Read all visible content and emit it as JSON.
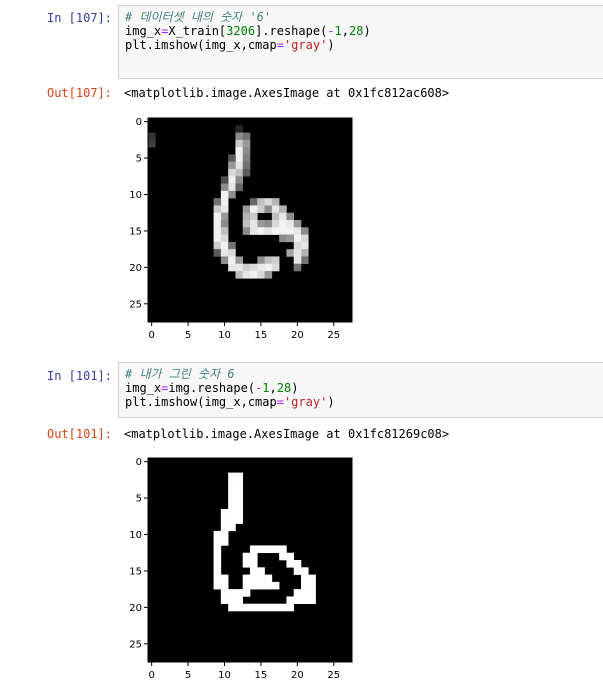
{
  "cells": [
    {
      "in_prompt": "In [107]:",
      "code": [
        [
          {
            "t": "# 데이터셋 내의 숫자 '6'",
            "c": "cmt"
          }
        ],
        [
          {
            "t": "img_x",
            "c": ""
          },
          {
            "t": "=",
            "c": "op"
          },
          {
            "t": "X_train[",
            "c": ""
          },
          {
            "t": "3206",
            "c": "num"
          },
          {
            "t": "].reshape(",
            "c": ""
          },
          {
            "t": "-",
            "c": "op"
          },
          {
            "t": "1",
            "c": "num"
          },
          {
            "t": ",",
            "c": ""
          },
          {
            "t": "28",
            "c": "num"
          },
          {
            "t": ")",
            "c": ""
          }
        ],
        [
          {
            "t": "plt.imshow(img_x,cmap",
            "c": ""
          },
          {
            "t": "=",
            "c": "op"
          },
          {
            "t": "'gray'",
            "c": "str"
          },
          {
            "t": ")",
            "c": ""
          }
        ]
      ],
      "out_prompt": "Out[107]:",
      "out_text": "<matplotlib.image.AxesImage at 0x1fc812ac608>",
      "plot": {
        "y_ticks": [
          "0",
          "5",
          "10",
          "15",
          "20",
          "25"
        ],
        "x_ticks": [
          "0",
          "5",
          "10",
          "15",
          "20",
          "25"
        ],
        "image": {
          "rows": 28,
          "cols": 28,
          "pixels": [
            [
              2,
              0,
              0.2
            ],
            [
              3,
              0,
              0.25
            ],
            [
              1,
              12,
              0.15
            ],
            [
              2,
              12,
              0.55
            ],
            [
              3,
              12,
              0.8
            ],
            [
              4,
              12,
              0.95
            ],
            [
              5,
              12,
              0.95
            ],
            [
              6,
              12,
              0.9
            ],
            [
              7,
              12,
              0.75
            ],
            [
              2,
              13,
              0.45
            ],
            [
              3,
              13,
              0.6
            ],
            [
              4,
              13,
              0.55
            ],
            [
              5,
              13,
              0.5
            ],
            [
              6,
              13,
              0.45
            ],
            [
              7,
              13,
              0.35
            ],
            [
              5,
              11,
              0.35
            ],
            [
              6,
              11,
              0.6
            ],
            [
              7,
              11,
              0.85
            ],
            [
              8,
              11,
              0.95
            ],
            [
              9,
              11,
              0.9
            ],
            [
              10,
              11,
              0.55
            ],
            [
              8,
              12,
              0.55
            ],
            [
              9,
              12,
              0.4
            ],
            [
              8,
              10,
              0.3
            ],
            [
              9,
              10,
              0.55
            ],
            [
              10,
              10,
              0.95
            ],
            [
              11,
              10,
              0.95
            ],
            [
              12,
              10,
              0.9
            ],
            [
              13,
              10,
              0.6
            ],
            [
              11,
              9,
              0.45
            ],
            [
              12,
              9,
              0.8
            ],
            [
              13,
              9,
              0.95
            ],
            [
              14,
              9,
              0.95
            ],
            [
              15,
              9,
              0.95
            ],
            [
              16,
              9,
              0.95
            ],
            [
              17,
              9,
              0.8
            ],
            [
              18,
              9,
              0.35
            ],
            [
              14,
              10,
              0.55
            ],
            [
              15,
              10,
              0.75
            ],
            [
              16,
              10,
              0.85
            ],
            [
              17,
              10,
              0.95
            ],
            [
              18,
              10,
              0.9
            ],
            [
              19,
              10,
              0.55
            ],
            [
              17,
              11,
              0.45
            ],
            [
              18,
              11,
              0.85
            ],
            [
              19,
              11,
              0.95
            ],
            [
              20,
              11,
              0.9
            ],
            [
              19,
              12,
              0.6
            ],
            [
              20,
              12,
              0.9
            ],
            [
              21,
              12,
              0.75
            ],
            [
              20,
              13,
              0.8
            ],
            [
              21,
              13,
              0.9
            ],
            [
              20,
              14,
              0.85
            ],
            [
              21,
              14,
              0.95
            ],
            [
              19,
              15,
              0.55
            ],
            [
              20,
              15,
              0.9
            ],
            [
              21,
              15,
              0.85
            ],
            [
              19,
              16,
              0.75
            ],
            [
              20,
              16,
              0.95
            ],
            [
              21,
              16,
              0.6
            ],
            [
              19,
              17,
              0.8
            ],
            [
              20,
              17,
              0.85
            ],
            [
              11,
              14,
              0.4
            ],
            [
              11,
              15,
              0.75
            ],
            [
              11,
              16,
              0.85
            ],
            [
              11,
              17,
              0.7
            ],
            [
              12,
              13,
              0.6
            ],
            [
              12,
              14,
              0.95
            ],
            [
              12,
              15,
              0.8
            ],
            [
              12,
              16,
              0.55
            ],
            [
              12,
              17,
              0.9
            ],
            [
              12,
              18,
              0.7
            ],
            [
              13,
              13,
              0.7
            ],
            [
              13,
              14,
              0.8
            ],
            [
              13,
              17,
              0.75
            ],
            [
              13,
              18,
              0.9
            ],
            [
              13,
              19,
              0.55
            ],
            [
              14,
              13,
              0.75
            ],
            [
              14,
              14,
              0.9
            ],
            [
              14,
              15,
              0.6
            ],
            [
              14,
              16,
              0.55
            ],
            [
              14,
              17,
              0.85
            ],
            [
              14,
              18,
              0.95
            ],
            [
              14,
              19,
              0.9
            ],
            [
              14,
              20,
              0.6
            ],
            [
              15,
              13,
              0.55
            ],
            [
              15,
              14,
              0.9
            ],
            [
              15,
              15,
              0.95
            ],
            [
              15,
              16,
              0.9
            ],
            [
              15,
              17,
              0.95
            ],
            [
              15,
              18,
              0.95
            ],
            [
              15,
              19,
              0.95
            ],
            [
              15,
              20,
              0.9
            ],
            [
              15,
              21,
              0.55
            ],
            [
              16,
              20,
              0.95
            ],
            [
              16,
              21,
              0.85
            ],
            [
              17,
              21,
              0.9
            ],
            [
              18,
              21,
              0.7
            ],
            [
              19,
              21,
              0.45
            ],
            [
              16,
              19,
              0.6
            ],
            [
              18,
              19,
              0.65
            ],
            [
              17,
              20,
              0.85
            ],
            [
              18,
              20,
              0.9
            ],
            [
              19,
              20,
              0.9
            ],
            [
              20,
              20,
              0.45
            ],
            [
              16,
              18,
              0.55
            ]
          ]
        }
      }
    },
    {
      "in_prompt": "In [101]:",
      "code": [
        [
          {
            "t": "# 내가 그린 숫자 6",
            "c": "cmt"
          }
        ],
        [
          {
            "t": "img_x",
            "c": ""
          },
          {
            "t": "=",
            "c": "op"
          },
          {
            "t": "img.reshape(",
            "c": ""
          },
          {
            "t": "-",
            "c": "op"
          },
          {
            "t": "1",
            "c": "num"
          },
          {
            "t": ",",
            "c": ""
          },
          {
            "t": "28",
            "c": "num"
          },
          {
            "t": ")",
            "c": ""
          }
        ],
        [
          {
            "t": "plt.imshow(img_x,cmap",
            "c": ""
          },
          {
            "t": "=",
            "c": "op"
          },
          {
            "t": "'gray'",
            "c": "str"
          },
          {
            "t": ")",
            "c": ""
          }
        ]
      ],
      "out_prompt": "Out[101]:",
      "out_text": "<matplotlib.image.AxesImage at 0x1fc81269c08>",
      "plot": {
        "y_ticks": [
          "0",
          "5",
          "10",
          "15",
          "20",
          "25"
        ],
        "x_ticks": [
          "0",
          "5",
          "10",
          "15",
          "20",
          "25"
        ],
        "image": {
          "rows": 28,
          "cols": 28,
          "pixels": [
            [
              2,
              11,
              1
            ],
            [
              3,
              11,
              1
            ],
            [
              4,
              11,
              1
            ],
            [
              5,
              11,
              1
            ],
            [
              6,
              11,
              1
            ],
            [
              7,
              11,
              1
            ],
            [
              8,
              11,
              1
            ],
            [
              9,
              11,
              1
            ],
            [
              2,
              12,
              1
            ],
            [
              3,
              12,
              1
            ],
            [
              4,
              12,
              1
            ],
            [
              5,
              12,
              1
            ],
            [
              6,
              12,
              1
            ],
            [
              7,
              12,
              1
            ],
            [
              8,
              12,
              1
            ],
            [
              7,
              10,
              1
            ],
            [
              8,
              10,
              1
            ],
            [
              9,
              10,
              1
            ],
            [
              10,
              10,
              1
            ],
            [
              11,
              10,
              1
            ],
            [
              10,
              9,
              1
            ],
            [
              11,
              9,
              1
            ],
            [
              12,
              9,
              1
            ],
            [
              13,
              9,
              1
            ],
            [
              14,
              9,
              1
            ],
            [
              15,
              9,
              1
            ],
            [
              16,
              9,
              1
            ],
            [
              17,
              9,
              1
            ],
            [
              16,
              10,
              1
            ],
            [
              17,
              10,
              1
            ],
            [
              18,
              10,
              1
            ],
            [
              19,
              10,
              1
            ],
            [
              18,
              11,
              1
            ],
            [
              19,
              11,
              1
            ],
            [
              20,
              11,
              1
            ],
            [
              19,
              12,
              1
            ],
            [
              20,
              12,
              1
            ],
            [
              20,
              13,
              1
            ],
            [
              20,
              14,
              1
            ],
            [
              20,
              15,
              1
            ],
            [
              20,
              16,
              1
            ],
            [
              20,
              17,
              1
            ],
            [
              20,
              18,
              1
            ],
            [
              20,
              19,
              1
            ],
            [
              19,
              19,
              1
            ],
            [
              19,
              20,
              1
            ],
            [
              19,
              21,
              1
            ],
            [
              19,
              22,
              1
            ],
            [
              18,
              20,
              1
            ],
            [
              18,
              21,
              1
            ],
            [
              18,
              22,
              1
            ],
            [
              17,
              21,
              1
            ],
            [
              17,
              22,
              1
            ],
            [
              16,
              22,
              1
            ],
            [
              16,
              21,
              1
            ],
            [
              15,
              21,
              1
            ],
            [
              15,
              20,
              1
            ],
            [
              14,
              20,
              1
            ],
            [
              14,
              19,
              1
            ],
            [
              13,
              19,
              1
            ],
            [
              13,
              18,
              1
            ],
            [
              12,
              18,
              1
            ],
            [
              12,
              17,
              1
            ],
            [
              12,
              16,
              1
            ],
            [
              12,
              15,
              1
            ],
            [
              12,
              14,
              1
            ],
            [
              13,
              14,
              1
            ],
            [
              14,
              14,
              1
            ],
            [
              15,
              14,
              1
            ],
            [
              16,
              14,
              1
            ],
            [
              17,
              14,
              1
            ],
            [
              13,
              13,
              1
            ],
            [
              14,
              13,
              1
            ],
            [
              16,
              13,
              1
            ],
            [
              17,
              13,
              1
            ],
            [
              15,
              15,
              1
            ],
            [
              16,
              15,
              1
            ],
            [
              17,
              15,
              1
            ],
            [
              16,
              16,
              1
            ],
            [
              17,
              16,
              1
            ],
            [
              17,
              17,
              1
            ],
            [
              18,
              13,
              1
            ],
            [
              18,
              12,
              1
            ]
          ]
        }
      }
    }
  ]
}
